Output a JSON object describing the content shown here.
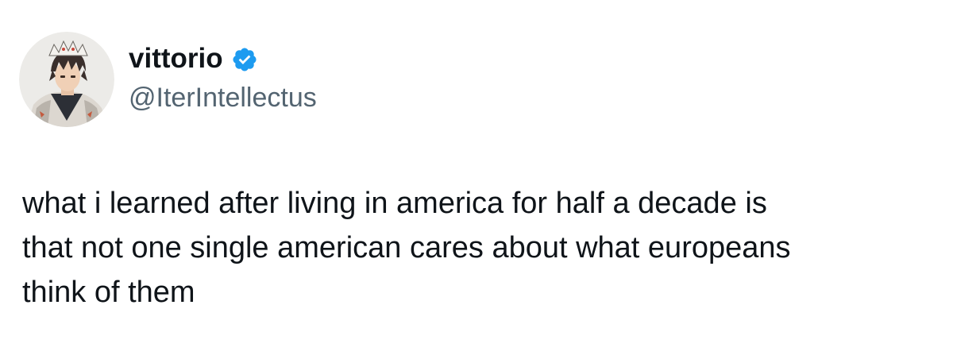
{
  "author": {
    "display_name": "vittorio",
    "handle": "@IterIntellectus",
    "verified": true,
    "verified_badge_color": "#1d9bf0",
    "avatar_icon": "anime-character-avatar"
  },
  "tweet": {
    "lines": [
      "what i learned after living in america for half a decade is",
      "that not one single american cares about what europeans",
      "think of them"
    ]
  },
  "colors": {
    "text": "#0f1419",
    "secondary_text": "#536471",
    "background": "#ffffff",
    "accent": "#1d9bf0"
  }
}
